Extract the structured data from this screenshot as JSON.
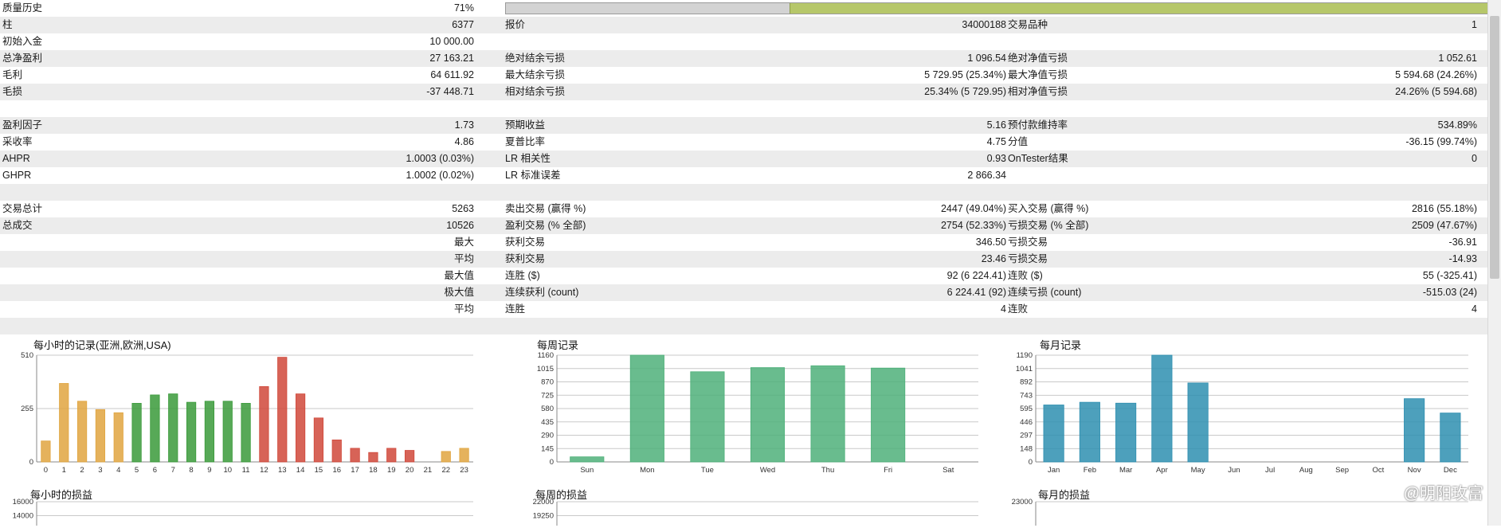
{
  "quality": {
    "label": "质量历史",
    "value": "71%",
    "fraction": 0.71
  },
  "rows": [
    {
      "c1": [
        "柱",
        "6377"
      ],
      "c2": [
        "报价",
        "34000188"
      ],
      "c3": [
        "交易品种",
        "1"
      ]
    },
    {
      "c1": [
        "初始入金",
        "10 000.00"
      ],
      "c2": [
        "",
        ""
      ],
      "c3": [
        "",
        ""
      ]
    },
    {
      "c1": [
        "总净盈利",
        "27 163.21"
      ],
      "c2": [
        "绝对结余亏损",
        "1 096.54"
      ],
      "c3": [
        "绝对净值亏损",
        "1 052.61"
      ]
    },
    {
      "c1": [
        "毛利",
        "64 611.92"
      ],
      "c2": [
        "最大结余亏损",
        "5 729.95 (25.34%)"
      ],
      "c3": [
        "最大净值亏损",
        "5 594.68 (24.26%)"
      ]
    },
    {
      "c1": [
        "毛损",
        "-37 448.71"
      ],
      "c2": [
        "相对结余亏损",
        "25.34% (5 729.95)"
      ],
      "c3": [
        "相对净值亏损",
        "24.26% (5 594.68)"
      ]
    },
    {
      "c1": [
        "",
        ""
      ],
      "c2": [
        "",
        ""
      ],
      "c3": [
        "",
        ""
      ]
    },
    {
      "c1": [
        "盈利因子",
        "1.73"
      ],
      "c2": [
        "预期收益",
        "5.16"
      ],
      "c3": [
        "预付款维持率",
        "534.89%"
      ]
    },
    {
      "c1": [
        "采收率",
        "4.86"
      ],
      "c2": [
        "夏普比率",
        "4.75"
      ],
      "c3": [
        "分值",
        "-36.15 (99.74%)"
      ]
    },
    {
      "c1": [
        "AHPR",
        "1.0003 (0.03%)"
      ],
      "c2": [
        "LR 相关性",
        "0.93"
      ],
      "c3": [
        "OnTester结果",
        "0"
      ]
    },
    {
      "c1": [
        "GHPR",
        "1.0002 (0.02%)"
      ],
      "c2": [
        "LR 标准误差",
        "2 866.34"
      ],
      "c3": [
        "",
        ""
      ]
    },
    {
      "c1": [
        "",
        ""
      ],
      "c2": [
        "",
        ""
      ],
      "c3": [
        "",
        ""
      ]
    },
    {
      "c1": [
        "交易总计",
        "5263"
      ],
      "c2": [
        "卖出交易 (赢得 %)",
        "2447 (49.04%)"
      ],
      "c3": [
        "买入交易 (赢得 %)",
        "2816 (55.18%)"
      ]
    },
    {
      "c1": [
        "总成交",
        "10526"
      ],
      "c2": [
        "盈利交易 (% 全部)",
        "2754 (52.33%)"
      ],
      "c3": [
        "亏损交易 (% 全部)",
        "2509 (47.67%)"
      ]
    },
    {
      "c1": [
        "",
        "最大"
      ],
      "c2": [
        "获利交易",
        "346.50"
      ],
      "c3": [
        "亏损交易",
        "-36.91"
      ]
    },
    {
      "c1": [
        "",
        "平均"
      ],
      "c2": [
        "获利交易",
        "23.46"
      ],
      "c3": [
        "亏损交易",
        "-14.93"
      ]
    },
    {
      "c1": [
        "",
        "最大值"
      ],
      "c2": [
        "连胜 ($)",
        "92 (6 224.41)"
      ],
      "c3": [
        "连败 ($)",
        "55 (-325.41)"
      ]
    },
    {
      "c1": [
        "",
        "极大值"
      ],
      "c2": [
        "连续获利 (count)",
        "6 224.41 (92)"
      ],
      "c3": [
        "连续亏损 (count)",
        "-515.03 (24)"
      ]
    },
    {
      "c1": [
        "",
        "平均"
      ],
      "c2": [
        "连胜",
        "4"
      ],
      "c3": [
        "连败",
        "4"
      ]
    },
    {
      "c1": [
        "",
        ""
      ],
      "c2": [
        "",
        ""
      ],
      "c3": [
        "",
        ""
      ]
    }
  ],
  "colors": {
    "orange": "#e0a540",
    "green": "#3a9a3a",
    "red": "#d0483a",
    "mint": "#4fb07a",
    "teal": "#2e8fb0",
    "blue": "#9aaedc",
    "quality_bar": "#b6c76a"
  },
  "chart_data": [
    {
      "type": "bar",
      "title": "每小时的记录(亚洲,欧洲,USA)",
      "categories": [
        "0",
        "1",
        "2",
        "3",
        "4",
        "5",
        "6",
        "7",
        "8",
        "9",
        "10",
        "11",
        "12",
        "13",
        "14",
        "15",
        "16",
        "17",
        "18",
        "19",
        "20",
        "21",
        "22",
        "23"
      ],
      "values": [
        100,
        375,
        290,
        250,
        235,
        280,
        320,
        325,
        285,
        290,
        290,
        280,
        360,
        500,
        325,
        210,
        105,
        65,
        45,
        65,
        55,
        0,
        50,
        65
      ],
      "bar_colors": [
        "orange",
        "orange",
        "orange",
        "orange",
        "orange",
        "green",
        "green",
        "green",
        "green",
        "green",
        "green",
        "green",
        "red",
        "red",
        "red",
        "red",
        "red",
        "red",
        "red",
        "red",
        "red",
        "red",
        "orange",
        "orange"
      ],
      "yticks": [
        0,
        255,
        510
      ],
      "ylim": [
        0,
        510
      ],
      "xlabel": "",
      "ylabel": ""
    },
    {
      "type": "bar",
      "title": "每周记录",
      "categories": [
        "Sun",
        "Mon",
        "Tue",
        "Wed",
        "Thu",
        "Fri",
        "Sat"
      ],
      "values": [
        55,
        1160,
        980,
        1025,
        1045,
        1020,
        0
      ],
      "bar_colors": [
        "mint",
        "mint",
        "mint",
        "mint",
        "mint",
        "mint",
        "mint"
      ],
      "yticks": [
        0,
        145,
        290,
        435,
        580,
        725,
        870,
        1015,
        1160
      ],
      "ylim": [
        0,
        1160
      ],
      "xlabel": "",
      "ylabel": ""
    },
    {
      "type": "bar",
      "title": "每月记录",
      "categories": [
        "Jan",
        "Feb",
        "Mar",
        "Apr",
        "May",
        "Jun",
        "Jul",
        "Aug",
        "Sep",
        "Oct",
        "Nov",
        "Dec"
      ],
      "values": [
        635,
        665,
        655,
        1190,
        880,
        0,
        0,
        0,
        0,
        0,
        705,
        545
      ],
      "bar_colors": [
        "teal",
        "teal",
        "teal",
        "teal",
        "teal",
        "teal",
        "teal",
        "teal",
        "teal",
        "teal",
        "teal",
        "teal"
      ],
      "yticks": [
        0,
        148,
        297,
        446,
        595,
        743,
        892,
        1041,
        1190
      ],
      "ylim": [
        0,
        1190
      ],
      "xlabel": "",
      "ylabel": ""
    },
    {
      "type": "bar",
      "title": "每小时的损益",
      "yticks": [
        16000,
        14000
      ],
      "ylim": [
        0,
        16000
      ]
    },
    {
      "type": "bar",
      "title": "每周的损益",
      "yticks": [
        22000,
        19250
      ],
      "ylim": [
        0,
        22000
      ]
    },
    {
      "type": "bar",
      "title": "每月的损益",
      "yticks": [
        23000
      ],
      "ylim": [
        0,
        23000
      ]
    }
  ],
  "watermark": "@明阳玫富"
}
